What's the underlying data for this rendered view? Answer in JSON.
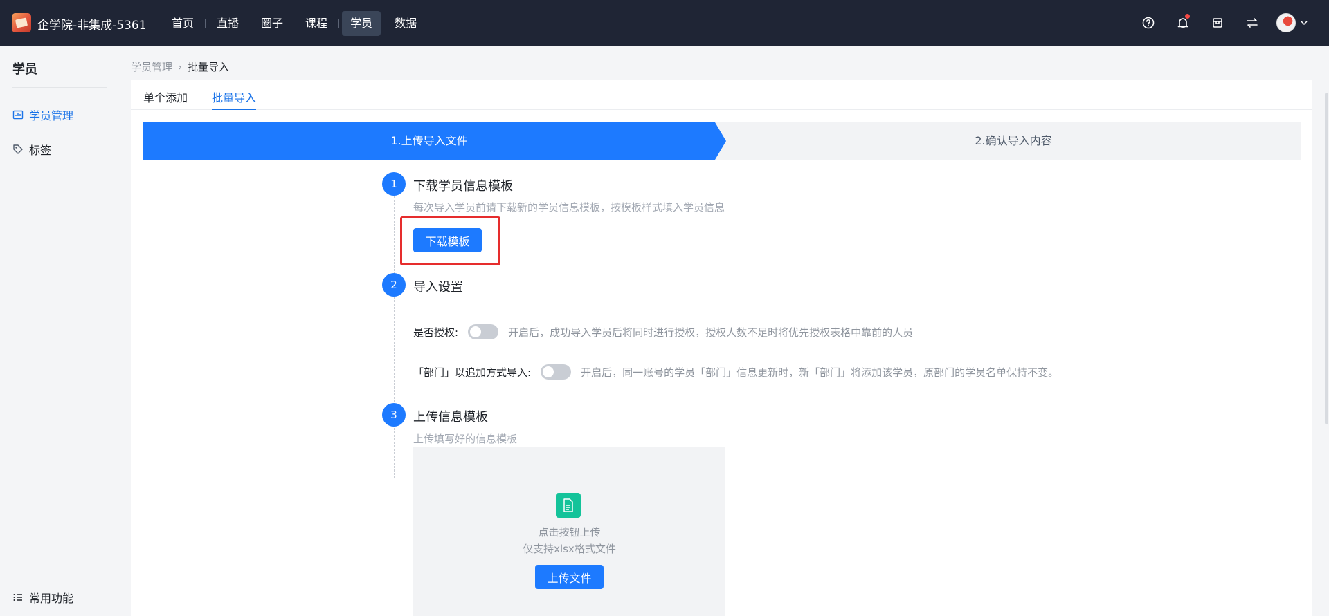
{
  "topbar": {
    "org_name": "企学院-非集成-5361",
    "nav": [
      "首页",
      "直播",
      "圈子",
      "课程",
      "学员",
      "数据"
    ],
    "active_nav": "学员",
    "icons": [
      "help-icon",
      "bell-icon",
      "store-icon",
      "switch-icon",
      "avatar"
    ]
  },
  "sidebar": {
    "title": "学员",
    "items": [
      {
        "label": "学员管理",
        "icon": "chart-icon",
        "active": true
      },
      {
        "label": "标签",
        "icon": "tag-icon",
        "active": false
      }
    ],
    "footer": "常用功能"
  },
  "breadcrumb": {
    "parent": "学员管理",
    "current": "批量导入"
  },
  "tabs": [
    {
      "label": "单个添加",
      "active": false
    },
    {
      "label": "批量导入",
      "active": true
    }
  ],
  "steps": {
    "step1": "1.上传导入文件",
    "step2": "2.确认导入内容"
  },
  "section1": {
    "num": "1",
    "title": "下载学员信息模板",
    "desc": "每次导入学员前请下载新的学员信息模板，按模板样式填入学员信息",
    "button": "下载模板"
  },
  "section2": {
    "num": "2",
    "title": "导入设置",
    "auth_label": "是否授权:",
    "auth_hint": "开启后，成功导入学员后将同时进行授权，授权人数不足时将优先授权表格中靠前的人员",
    "dept_label": "「部门」以追加方式导入:",
    "dept_hint": "开启后，同一账号的学员「部门」信息更新时，新「部门」将添加该学员，原部门的学员名单保持不变。"
  },
  "section3": {
    "num": "3",
    "title": "上传信息模板",
    "desc": "上传填写好的信息模板",
    "upload_line1": "点击按钮上传",
    "upload_line2": "仅支持xlsx格式文件",
    "button": "上传文件"
  },
  "colors": {
    "primary": "#1d7aff",
    "topbar": "#1f2535",
    "highlight": "#e62d2d"
  }
}
